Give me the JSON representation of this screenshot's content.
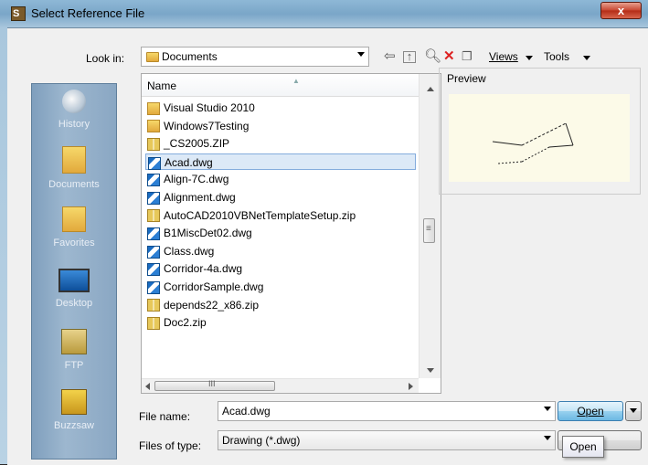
{
  "window": {
    "title": "Select Reference File",
    "close_glyph": "x"
  },
  "toolbar": {
    "look_in_label": "Look in:",
    "look_in_value": "Documents",
    "views_label": "Views",
    "tools_label": "Tools"
  },
  "places": [
    {
      "label": "History",
      "icon": "history-icon"
    },
    {
      "label": "Documents",
      "icon": "documents-icon"
    },
    {
      "label": "Favorites",
      "icon": "favorites-icon"
    },
    {
      "label": "Desktop",
      "icon": "desktop-icon"
    },
    {
      "label": "FTP",
      "icon": "ftp-icon"
    },
    {
      "label": "Buzzsaw",
      "icon": "buzzsaw-icon"
    }
  ],
  "file_list": {
    "column_name": "Name",
    "items": [
      {
        "name": "Visual Studio 2010",
        "type": "folder"
      },
      {
        "name": "Windows7Testing",
        "type": "folder"
      },
      {
        "name": "_CS2005.ZIP",
        "type": "zip"
      },
      {
        "name": "Acad.dwg",
        "type": "dwg"
      },
      {
        "name": "Align-7C.dwg",
        "type": "dwg"
      },
      {
        "name": "Alignment.dwg",
        "type": "dwg"
      },
      {
        "name": "AutoCAD2010VBNetTemplateSetup.zip",
        "type": "zip"
      },
      {
        "name": "B1MiscDet02.dwg",
        "type": "dwg"
      },
      {
        "name": "Class.dwg",
        "type": "dwg"
      },
      {
        "name": "Corridor-4a.dwg",
        "type": "dwg"
      },
      {
        "name": "CorridorSample.dwg",
        "type": "dwg"
      },
      {
        "name": "depends22_x86.zip",
        "type": "zip"
      },
      {
        "name": "Doc2.zip",
        "type": "zip"
      }
    ],
    "selected": "Acad.dwg",
    "hscroll_grip": "III",
    "vscroll_grip": "≡"
  },
  "preview": {
    "label": "Preview"
  },
  "form": {
    "file_name_label": "File name:",
    "file_name_value": "Acad.dwg",
    "file_type_label": "Files of type:",
    "file_type_value": "Drawing (*.dwg)",
    "open_label": "Open",
    "tooltip": "Open"
  },
  "colors": {
    "selection": "#dce9f7",
    "places_panel": "#8aa7c3",
    "preview_bg": "#fcfae8"
  }
}
